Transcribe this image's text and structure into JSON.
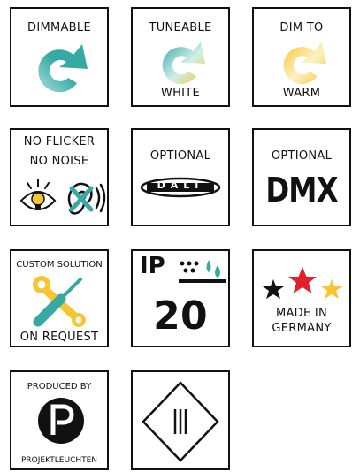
{
  "tiles": {
    "dimmable": {
      "label": "DIMMABLE"
    },
    "tuneable": {
      "label_top": "TUNEABLE",
      "label_bottom": "WHITE"
    },
    "dimtowarm": {
      "label_top": "DIM TO",
      "label_bottom": "WARM"
    },
    "noflicker": {
      "line1": "NO FLICKER",
      "line2": "NO NOISE"
    },
    "dali": {
      "label": "OPTIONAL",
      "logo_text": "DALI"
    },
    "dmx": {
      "label": "OPTIONAL",
      "logo_text": "DMX"
    },
    "custom": {
      "label_top": "CUSTOM SOLUTION",
      "label_bottom": "ON REQUEST"
    },
    "ip": {
      "prefix": "IP",
      "rating": "20"
    },
    "germany": {
      "line1": "MADE IN",
      "line2": "GERMANY"
    },
    "produced": {
      "label_top": "PRODUCED BY",
      "label_bottom": "PROJEKTLEUCHTEN"
    },
    "class2": {}
  },
  "colors": {
    "teal": "#37A9A4",
    "teal_light": "#8FD3D0",
    "yellow": "#F6C531",
    "red": "#E3202A",
    "black": "#111111"
  },
  "icons": [
    "refresh-arrow-icon",
    "refresh-arrow-gradient-icon",
    "refresh-arrow-warm-icon",
    "eye-bulb-icon",
    "ear-muted-icon",
    "dali-logo-icon",
    "wrench-screwdriver-icon",
    "water-drops-icon",
    "stars-icon",
    "p-logo-icon",
    "protection-class-icon"
  ]
}
